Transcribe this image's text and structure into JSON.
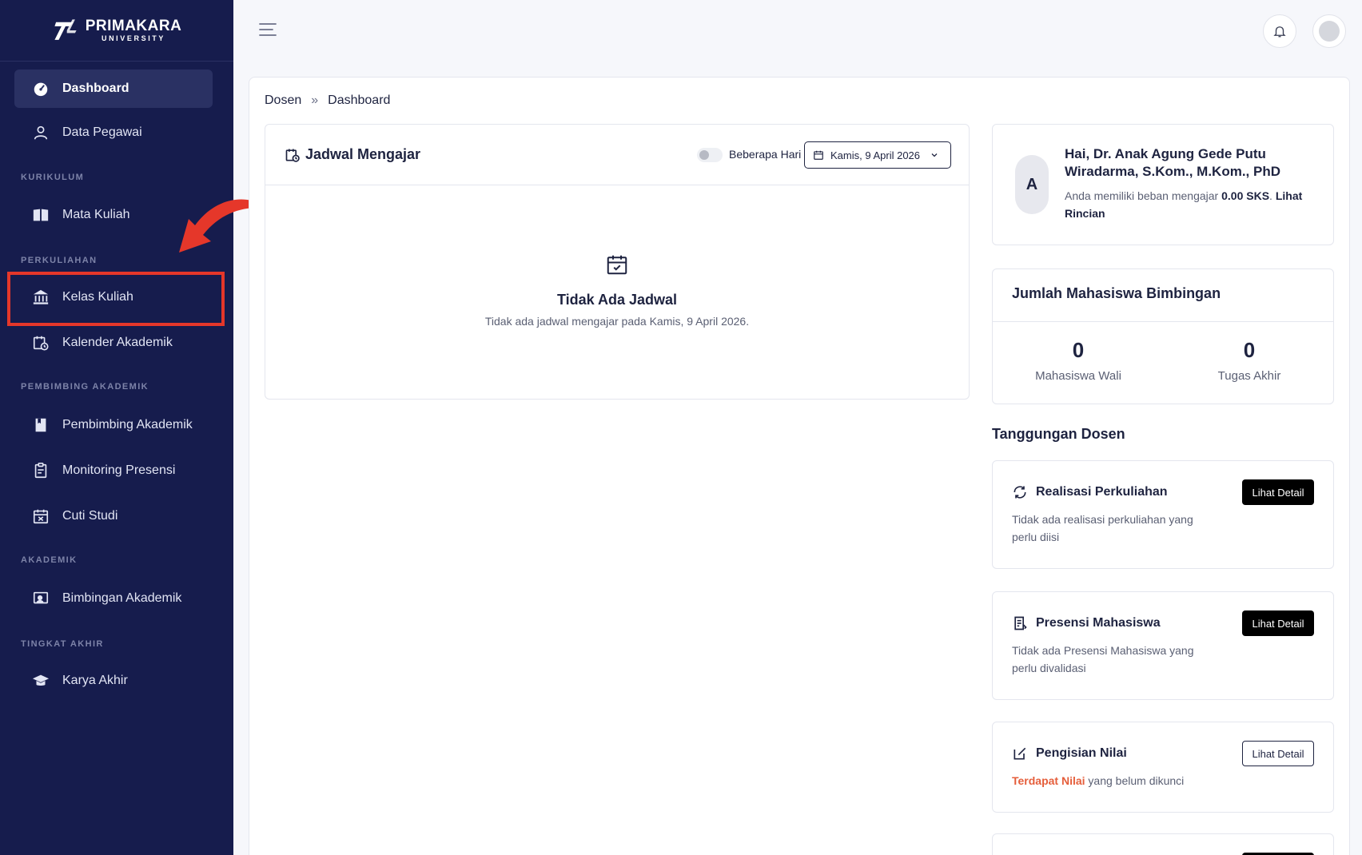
{
  "brand": {
    "name": "PRIMAKARA",
    "sub": "UNIVERSITY"
  },
  "sidebar": {
    "items": [
      {
        "label": "Dashboard"
      },
      {
        "label": "Data Pegawai"
      },
      {
        "label": "Mata Kuliah"
      },
      {
        "label": "Kelas Kuliah"
      },
      {
        "label": "Kalender Akademik"
      },
      {
        "label": "Pembimbing Akademik"
      },
      {
        "label": "Monitoring Presensi"
      },
      {
        "label": "Cuti Studi"
      },
      {
        "label": "Bimbingan Akademik"
      },
      {
        "label": "Karya Akhir"
      }
    ],
    "sections": [
      "KURIKULUM",
      "PERKULIAHAN",
      "PEMBIMBING AKADEMIK",
      "AKADEMIK",
      "TINGKAT AKHIR"
    ]
  },
  "breadcrumb": {
    "parent": "Dosen",
    "sep": "»",
    "current": "Dashboard"
  },
  "jadwal": {
    "title": "Jadwal Mengajar",
    "toggle_label": "Beberapa Hari",
    "date": "Kamis, 9 April 2026",
    "empty_title": "Tidak Ada Jadwal",
    "empty_sub": "Tidak ada jadwal mengajar pada Kamis, 9 April 2026."
  },
  "hai": {
    "avatar": "A",
    "name": "Hai, Dr. Anak Agung Gede Putu Wiradarma, S.Kom., M.Kom., PhD",
    "desc_prefix": "Anda memiliki beban mengajar ",
    "sks": "0.00 SKS",
    "desc_dot": ". ",
    "link": "Lihat Rincian"
  },
  "jumlah": {
    "title": "Jumlah Mahasiswa Bimbingan",
    "wali_value": "0",
    "wali_label": "Mahasiswa Wali",
    "ta_value": "0",
    "ta_label": "Tugas Akhir"
  },
  "tanggungan": {
    "title": "Tanggungan Dosen",
    "realisasi": {
      "title": "Realisasi Perkuliahan",
      "desc": "Tidak ada realisasi perkuliahan yang perlu diisi",
      "button": "Lihat Detail"
    },
    "presensi": {
      "title": "Presensi Mahasiswa",
      "desc": "Tidak ada Presensi Mahasiswa yang perlu divalidasi",
      "button": "Lihat Detail"
    },
    "nilai": {
      "title": "Pengisian Nilai",
      "desc_highlight": "Terdapat Nilai",
      "desc_rest": " yang belum dikunci",
      "button": "Lihat Detail"
    }
  },
  "colors": {
    "sidebar": "#161c4d",
    "active": "#2a3163",
    "highlight": "#e5372a",
    "warning": "#e55e3b"
  }
}
